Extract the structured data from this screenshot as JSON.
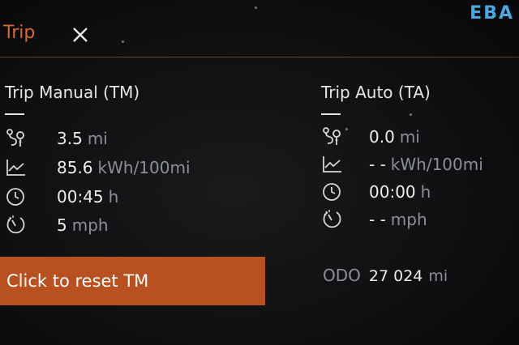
{
  "header": {
    "title": "Trip",
    "close_icon": "close-icon",
    "logo": "EBA",
    "accent_color": "#d86a30",
    "logo_color": "#4aa8e0"
  },
  "manual": {
    "title": "Trip Manual (TM)",
    "rows": [
      {
        "icon": "route-icon",
        "value": "3.5",
        "unit": "mi"
      },
      {
        "icon": "consumption-chart-icon",
        "value": "85.6",
        "unit": "kWh/100mi"
      },
      {
        "icon": "clock-icon",
        "value": "00:45",
        "unit": "h"
      },
      {
        "icon": "speedometer-icon",
        "value": "5",
        "unit": "mph"
      }
    ],
    "reset_label": "Click to reset TM",
    "reset_color": "#b8501f"
  },
  "auto": {
    "title": "Trip Auto (TA)",
    "rows": [
      {
        "icon": "route-icon",
        "value": "0.0",
        "unit": "mi"
      },
      {
        "icon": "consumption-chart-icon",
        "value": "- -",
        "unit": "kWh/100mi"
      },
      {
        "icon": "clock-icon",
        "value": "00:00",
        "unit": "h"
      },
      {
        "icon": "speedometer-icon",
        "value": "- -",
        "unit": "mph"
      }
    ]
  },
  "odo": {
    "label": "ODO",
    "value": "27 024",
    "unit": "mi"
  }
}
